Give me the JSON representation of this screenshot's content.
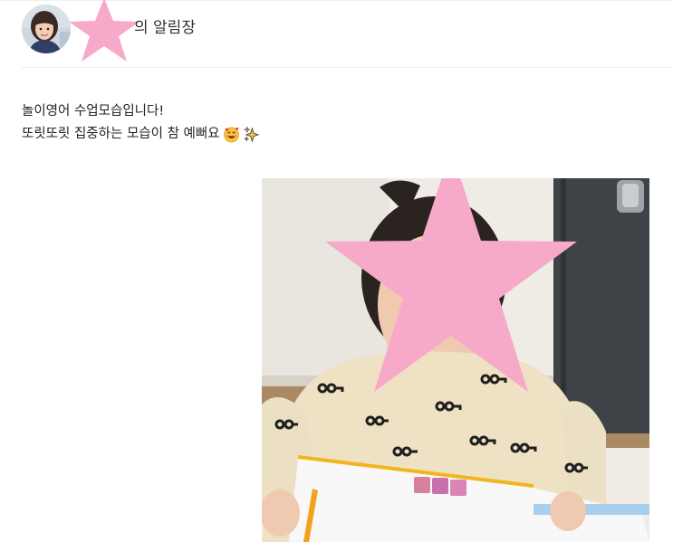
{
  "header": {
    "title_suffix": "의 알림장"
  },
  "post": {
    "lines": [
      "놀이영어 수업모습입니다!",
      "또릿또릿 집중하는 모습이 참 예뻐요"
    ],
    "emojis": [
      "smiling-face-with-hearts-icon",
      "sparkles-icon"
    ]
  },
  "colors": {
    "sticker_pink": "#f7a9c9",
    "divider": "#ececec"
  }
}
